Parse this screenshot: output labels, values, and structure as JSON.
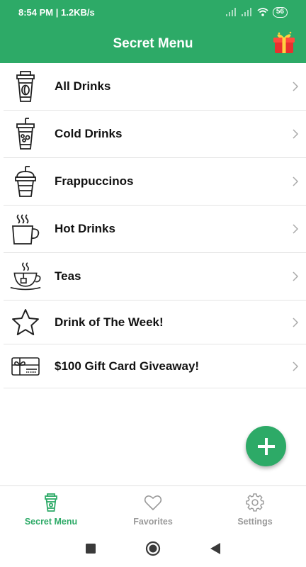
{
  "status": {
    "time_speed": "8:54 PM | 1.2KB/s",
    "battery": "56"
  },
  "header": {
    "title": "Secret Menu"
  },
  "menu": [
    {
      "label": "All Drinks",
      "icon": "coffee-cup-icon"
    },
    {
      "label": "Cold Drinks",
      "icon": "iced-drink-icon"
    },
    {
      "label": "Frappuccinos",
      "icon": "frappuccino-icon"
    },
    {
      "label": "Hot Drinks",
      "icon": "hot-mug-icon"
    },
    {
      "label": "Teas",
      "icon": "tea-cup-icon"
    },
    {
      "label": "Drink of The Week!",
      "icon": "star-icon"
    },
    {
      "label": "$100 Gift Card Giveaway!",
      "icon": "gift-card-icon"
    }
  ],
  "bottom_nav": [
    {
      "label": "Secret Menu",
      "icon": "cup-icon",
      "active": true
    },
    {
      "label": "Favorites",
      "icon": "heart-icon",
      "active": false
    },
    {
      "label": "Settings",
      "icon": "gear-icon",
      "active": false
    }
  ],
  "colors": {
    "primary": "#2daa67",
    "inactive": "#9a9a9a"
  }
}
